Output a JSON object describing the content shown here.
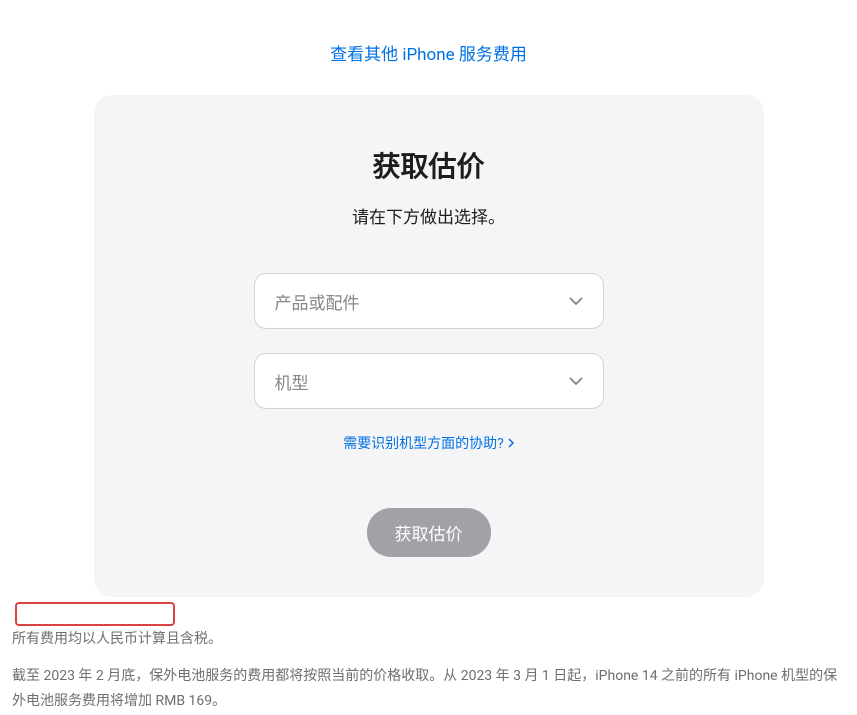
{
  "topLink": "查看其他 iPhone 服务费用",
  "card": {
    "title": "获取估价",
    "subtitle": "请在下方做出选择。",
    "select1": "产品或配件",
    "select2": "机型",
    "helpLink": "需要识别机型方面的协助?",
    "submitBtn": "获取估价"
  },
  "footer": {
    "line1": "所有费用均以人民币计算且含税。",
    "line2": "截至 2023 年 2 月底，保外电池服务的费用都将按照当前的价格收取。从 2023 年 3 月 1 日起，iPhone 14 之前的所有 iPhone 机型的保外电池服务费用将增加 RMB 169。"
  }
}
